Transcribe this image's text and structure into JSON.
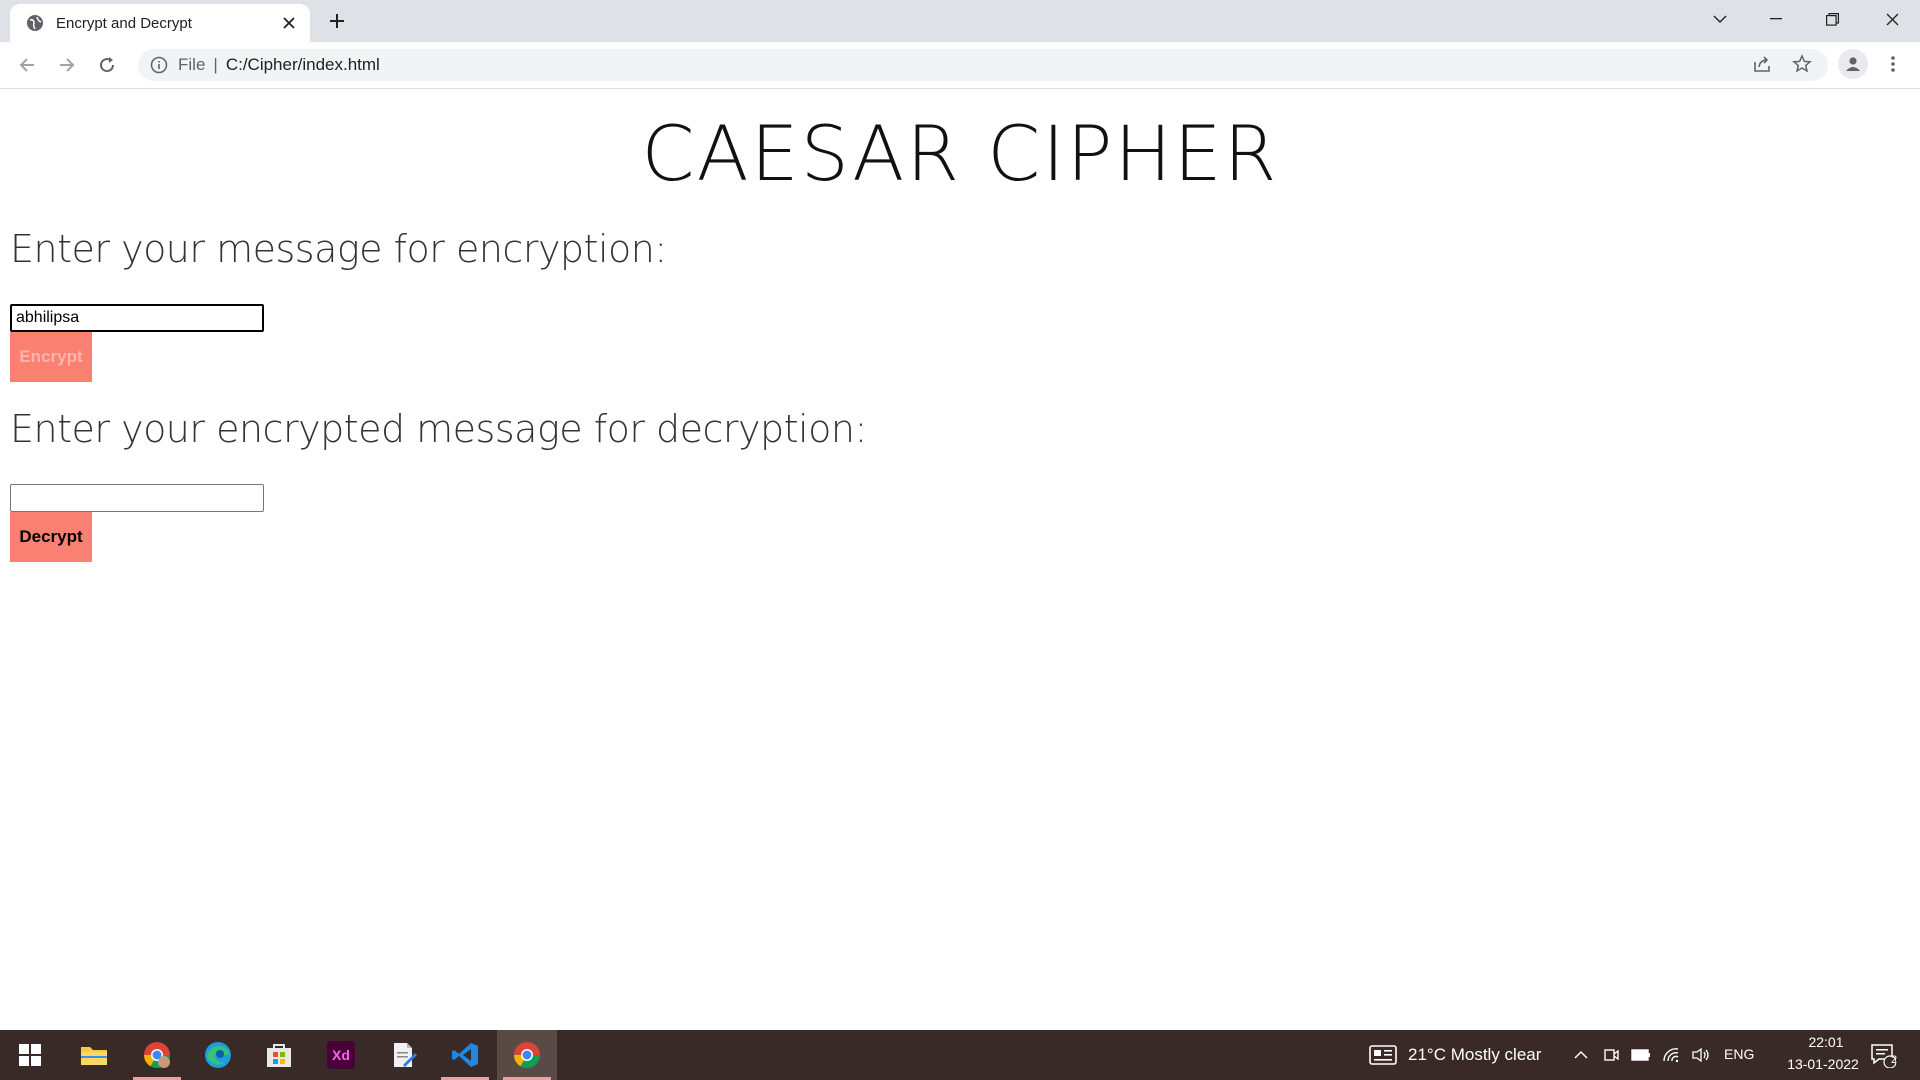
{
  "browser": {
    "tab_title": "Encrypt and Decrypt",
    "address_scheme": "File",
    "address_url": "C:/Cipher/index.html"
  },
  "page": {
    "heading": "CAESAR CIPHER",
    "encrypt_label": "Enter your message for encryption:",
    "encrypt_input_value": "abhilipsa",
    "encrypt_button": "Encrypt",
    "decrypt_label": "Enter your encrypted message for decryption:",
    "decrypt_input_value": "",
    "decrypt_button": "Decrypt"
  },
  "taskbar": {
    "apps": [
      "start",
      "file-explorer",
      "chrome-profile",
      "edge",
      "microsoft-store",
      "adobe-xd",
      "notepad-editor",
      "vscode",
      "chrome"
    ],
    "weather": "21°C  Mostly clear",
    "language": "ENG",
    "time": "22:01",
    "date": "13-01-2022",
    "notification_count": "2"
  },
  "colors": {
    "button": "#fa8072",
    "taskbar": "#3a2a27",
    "tabbar": "#dee1e6"
  }
}
